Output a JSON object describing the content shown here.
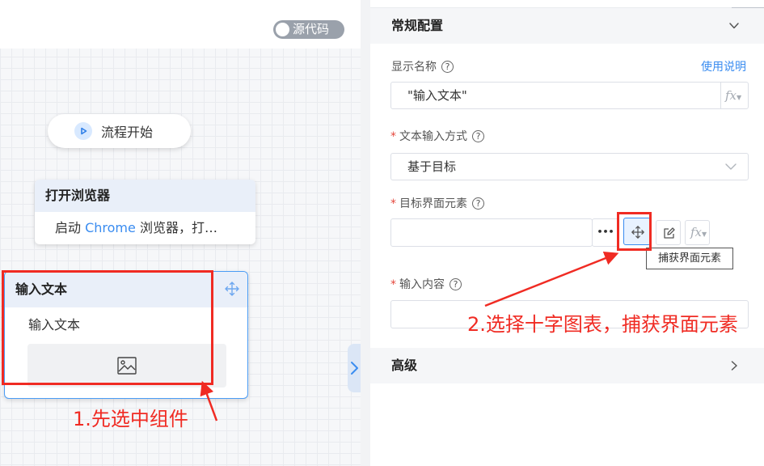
{
  "canvas": {
    "toggle_label": "源代码",
    "start_node": {
      "label": "流程开始"
    },
    "browser_node": {
      "title": "打开浏览器",
      "desc_prefix": "启动 ",
      "desc_highlight": "Chrome",
      "desc_suffix": " 浏览器，打…"
    },
    "input_node": {
      "title": "输入文本",
      "desc": "输入文本"
    }
  },
  "panel": {
    "general_section": "常规配置",
    "display_name_label": "显示名称",
    "help_link": "使用说明",
    "display_name_value": "\"输入文本\"",
    "fx_label": "fx",
    "input_method_label": "文本输入方式",
    "input_method_value": "基于目标",
    "target_label": "目标界面元素",
    "target_value": "",
    "more_label": "•••",
    "capture_tooltip": "捕获界面元素",
    "content_label": "输入内容",
    "content_value": "",
    "advanced_section": "高级",
    "required_mark": "*",
    "help_mark": "?"
  },
  "annotations": {
    "step1": "1.先选中组件",
    "step2": "2.选择十字图表，捕获界面元素",
    "color": "#f02b23"
  },
  "colors": {
    "accent": "#3a8cf0",
    "node_header": "#e9eff9",
    "toggle_bg": "#9aa1ab"
  },
  "icons": [
    "play-icon",
    "move-icon",
    "image-icon",
    "chevron-down-icon",
    "chevron-right-icon",
    "edit-icon",
    "help-icon",
    "collapse-arrow-icon"
  ]
}
